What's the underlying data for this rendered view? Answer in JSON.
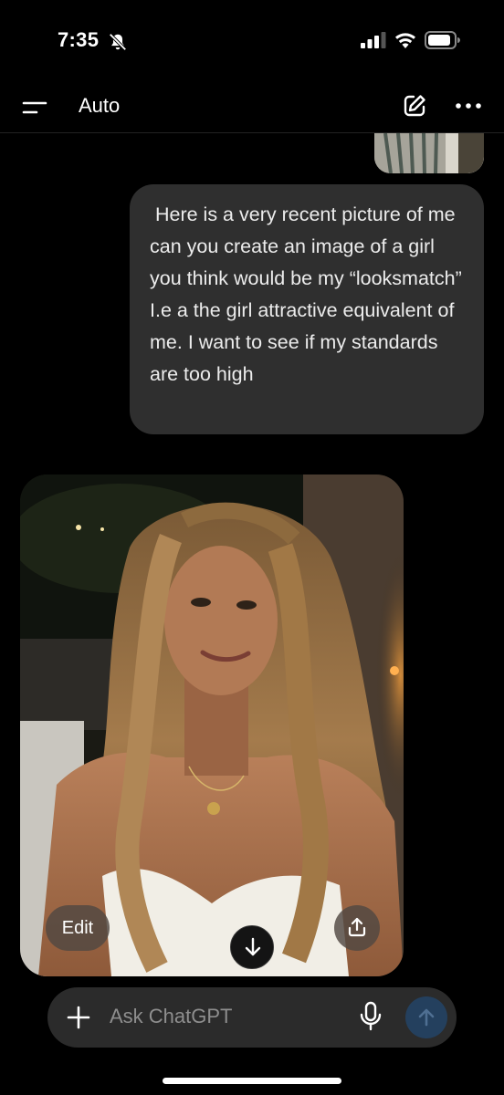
{
  "status_bar": {
    "time": "7:35",
    "icons": [
      "bell-slash-icon",
      "signal-icon",
      "wifi-icon",
      "battery-icon"
    ]
  },
  "header": {
    "title": "Auto",
    "icons": [
      "menu-icon",
      "compose-icon",
      "more-icon"
    ]
  },
  "conversation": {
    "user_message": " Here is a very recent picture of me can you create an image of a girl you think would be my “looksmatch” I.e a the girl attractive equivalent of me. I want to see if my standards are too high",
    "generated_image": {
      "edit_label": "Edit",
      "icons": [
        "download-icon",
        "share-icon"
      ]
    }
  },
  "composer": {
    "placeholder": "Ask ChatGPT",
    "value": "",
    "icons": [
      "plus-icon",
      "microphone-icon",
      "send-arrow-icon"
    ]
  },
  "colors": {
    "background": "#000000",
    "bubble": "#2f2f2f",
    "composer": "#2b2b2b",
    "send_button": "#24405e",
    "text": "#ececec",
    "placeholder": "#8e8e8e"
  }
}
